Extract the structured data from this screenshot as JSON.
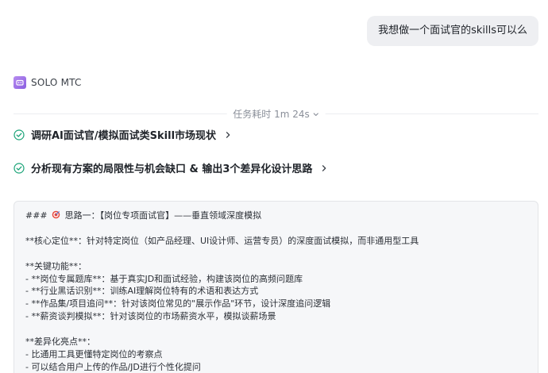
{
  "user_message": "我想做一个面试官的skills可以么",
  "agent": {
    "name": "SOLO MTC",
    "icon": "robot-icon"
  },
  "task_time": {
    "label": "任务耗时 1m 24s"
  },
  "steps": [
    {
      "label": "调研AI面试官/模拟面试类Skill市场现状",
      "status": "done"
    },
    {
      "label": "分析现有方案的局限性与机会缺口 & 输出3个差异化设计思路",
      "status": "done"
    }
  ],
  "output": {
    "heading_prefix": "### ",
    "heading_text": " 思路一：【岗位专项面试官】——垂直领域深度模拟",
    "lines": [
      "",
      "**核心定位**：针对特定岗位（如产品经理、UI设计师、运营专员）的深度面试模拟，而非通用型工具",
      "",
      "**关键功能**：",
      "- **岗位专属题库**：基于真实JD和面试经验，构建该岗位的高频问题库",
      "- **行业黑话识别**：训练AI理解岗位特有的术语和表达方式",
      "- **作品集/项目追问**：针对该岗位常见的\"展示作品\"环节，设计深度追问逻辑",
      "- **薪资谈判模拟**：针对该岗位的市场薪资水平，模拟谈薪场景",
      "",
      "**差异化亮点**：",
      "- 比通用工具更懂特定岗位的考察点",
      "- 可以结合用户上传的作品/JD进行个性化提问"
    ]
  },
  "colors": {
    "accent_check": "#1aa377",
    "agent_logo": "#9b6be8"
  }
}
